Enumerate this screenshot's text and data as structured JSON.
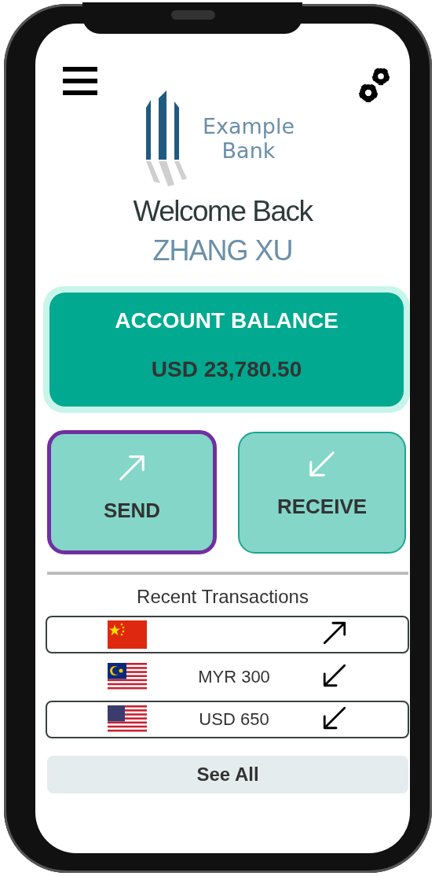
{
  "bank_name": "Example Bank",
  "welcome": "Welcome Back",
  "user_name": "ZHANG XU",
  "balance": {
    "title": "ACCOUNT BALANCE",
    "amount": "USD 23,780.50"
  },
  "actions": [
    {
      "label": "SEND",
      "kind": "out",
      "selected": true
    },
    {
      "label": "RECEIVE",
      "kind": "in",
      "selected": false
    }
  ],
  "transactions_title": "Recent Transactions",
  "transactions": [
    {
      "flag": {
        "kind": "cn"
      },
      "arrow": {
        "kind": "out"
      },
      "outlined": true
    },
    {
      "flag": {
        "kind": "my"
      },
      "amount": "MYR 300",
      "arrow": {
        "kind": "in"
      },
      "outlined": false
    },
    {
      "flag": {
        "kind": "us"
      },
      "amount": "USD 650",
      "arrow": {
        "kind": "in"
      },
      "outlined": true
    }
  ],
  "see_all": "See All"
}
